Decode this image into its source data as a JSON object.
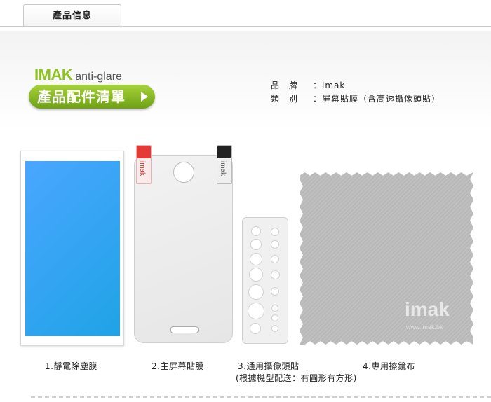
{
  "tab": {
    "label": "產品信息"
  },
  "brand": {
    "name": "IMAK",
    "tagline": "anti-glare"
  },
  "banner": {
    "title": "產品配件清單"
  },
  "info": [
    {
      "key": "品　牌",
      "value": "：imak"
    },
    {
      "key": "類　別",
      "value": "：屏幕貼膜（含高透攝像頭貼）"
    }
  ],
  "protector_tags": {
    "left": "imak",
    "right": "imak"
  },
  "cloth": {
    "logo": "imak",
    "url": "www.imak.hk"
  },
  "captions": {
    "item1": "1.靜電除塵膜",
    "item2": "2.主屏幕貼膜",
    "item3": "3.通用攝像頭貼",
    "item3_note": "(根據機型配送：有圓形有方形)",
    "item4": "4.專用擦鏡布"
  },
  "colors": {
    "brand_green": "#8dc21f",
    "screen_blue": "#2ea8f0",
    "cloth_gray": "#b9b9b9"
  }
}
